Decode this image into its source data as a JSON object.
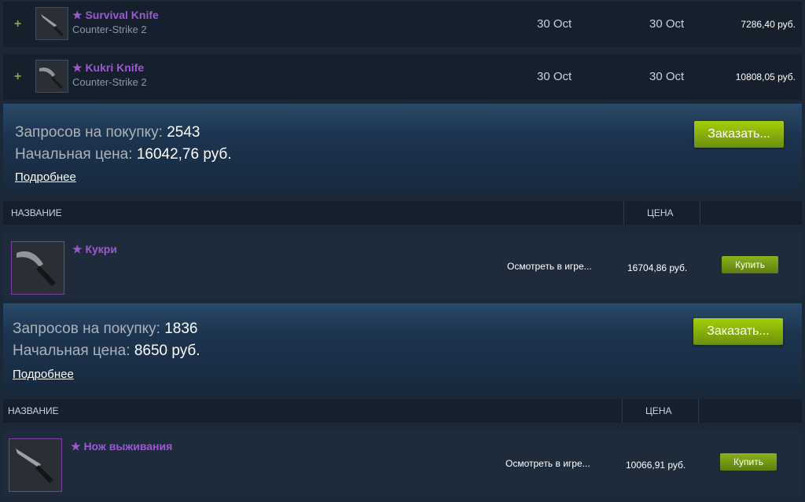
{
  "listings": [
    {
      "name": "★ Survival Knife",
      "game": "Counter-Strike 2",
      "date1": "30 Oct",
      "date2": "30 Oct",
      "price": "7286,40 руб.",
      "plus": "+"
    },
    {
      "name": "★ Kukri Knife",
      "game": "Counter-Strike 2",
      "date1": "30 Oct",
      "date2": "30 Oct",
      "price": "10808,05 руб.",
      "plus": "+"
    }
  ],
  "orders": [
    {
      "requests_label": "Запросов на покупку:",
      "requests_value": "2543",
      "start_label": "Начальная цена:",
      "start_value": "16042,76 руб.",
      "more": "Подробнее",
      "order_button": "Заказать...",
      "header_name": "НАЗВАНИЕ",
      "header_price": "ЦЕНА",
      "item": {
        "name": "★ Кукри",
        "inspect": "Осмотреть в игре...",
        "price": "16704,86 руб.",
        "buy": "Купить"
      }
    },
    {
      "requests_label": "Запросов на покупку:",
      "requests_value": "1836",
      "start_label": "Начальная цена:",
      "start_value": "8650 руб.",
      "more": "Подробнее",
      "order_button": "Заказать...",
      "header_name": "НАЗВАНИЕ",
      "header_price": "ЦЕНА",
      "item": {
        "name": "★ Нож выживания",
        "inspect": "Осмотреть в игре...",
        "price": "10066,91 руб.",
        "buy": "Купить"
      }
    }
  ],
  "colors": {
    "background": "#1b2838",
    "item_name": "#9b59d0",
    "button_green": "#a4d007"
  }
}
